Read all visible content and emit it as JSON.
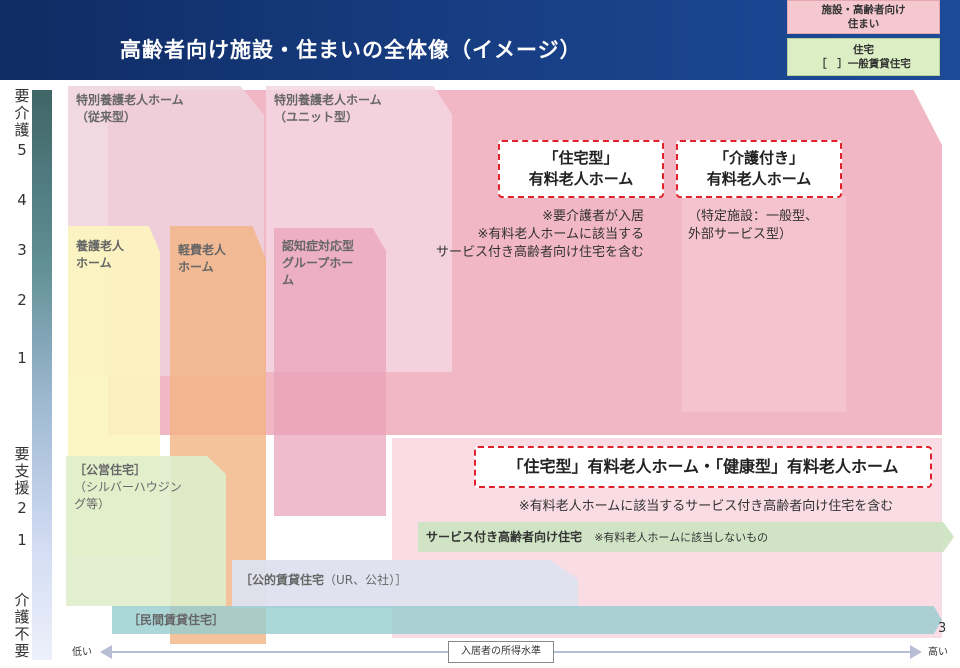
{
  "title": "高齢者向け施設・住まいの全体像（イメージ）",
  "legend": {
    "facility_line1": "施設・高齢者向け",
    "facility_line2": "住まい",
    "housing_line1": "住宅",
    "housing_line2": "［　］一般賃貸住宅"
  },
  "y_axis": {
    "care_needed": [
      "要",
      "介",
      "護"
    ],
    "care_levels": [
      "5",
      "4",
      "3",
      "2",
      "1"
    ],
    "support_needed": [
      "要",
      "支",
      "援"
    ],
    "support_levels": [
      "2",
      "1"
    ],
    "no_care": [
      "介",
      "護",
      "不",
      "要"
    ]
  },
  "shapes": {
    "traditional": {
      "line1": "特別養護老人ホーム",
      "line2": "（従来型）"
    },
    "unit": {
      "line1": "特別養護老人ホーム",
      "line2": "（ユニット型）"
    },
    "yogo": {
      "line1": "養護老人",
      "line2": "ホーム"
    },
    "keihi": {
      "line1": "軽費老人",
      "line2": "ホーム"
    },
    "group_home": {
      "line1": "認知症対応型",
      "line2": "グループホー",
      "line3": "ム"
    },
    "public_housing": {
      "line1": "［公営住宅］",
      "line2": "（シルバーハウジン",
      "line3": "グ等）"
    },
    "public_rental": {
      "bold": "［公的賃貸住宅",
      "plain": "（UR、公社）］"
    },
    "private_rental": "［民間賃貸住宅］",
    "sakoju": {
      "bold": "サービス付き高齢者向け住宅",
      "note": "※有料老人ホームに該当しないもの"
    }
  },
  "dashed": {
    "jutaku_type": {
      "line1": "「住宅型」",
      "line2": "有料老人ホーム"
    },
    "kaigo_type": {
      "line1": "「介護付き」",
      "line2": "有料老人ホーム"
    },
    "lower": "「住宅型」有料老人ホーム・「健康型」有料老人ホーム"
  },
  "notes": {
    "jutaku1": "※要介護者が入居",
    "jutaku2": "※有料老人ホームに該当する",
    "jutaku3": "サービス付き高齢者向け住宅を含む",
    "kaigo1": "（特定施設：一般型、",
    "kaigo2": "外部サービス型）",
    "lower": "※有料老人ホームに該当するサービス付き高齢者向け住宅を含む"
  },
  "x_axis": {
    "low": "低い",
    "high": "高い",
    "label": "入居者の所得水準"
  },
  "page_number": "3"
}
